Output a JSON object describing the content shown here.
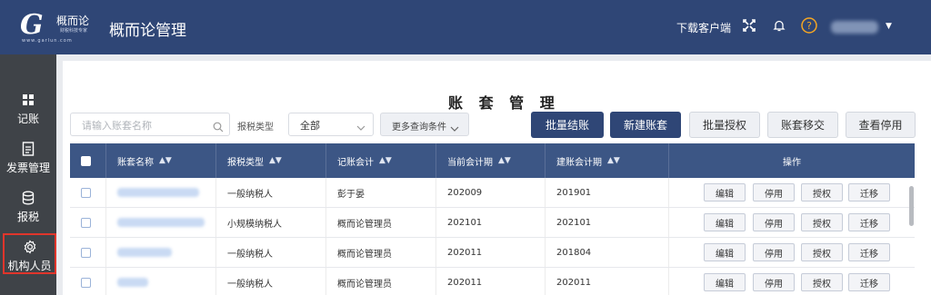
{
  "header": {
    "logo_letter": "G",
    "logo_cn": "概而论",
    "logo_subtitle": "财税科技专家",
    "logo_url": "www.garlun.com",
    "app_title": "概而论管理",
    "download_label": "下载客户端",
    "icons": [
      "fullscreen-icon",
      "bell-icon",
      "help-icon",
      "chevron-down-icon"
    ]
  },
  "sidebar": {
    "items": [
      {
        "label": "记账",
        "icon": "grid-icon"
      },
      {
        "label": "发票管理",
        "icon": "invoice-icon"
      },
      {
        "label": "报税",
        "icon": "database-icon"
      },
      {
        "label": "机构人员",
        "icon": "gear-icon",
        "active": true
      }
    ]
  },
  "page": {
    "title": "账 套 管 理"
  },
  "filters": {
    "search_placeholder": "请输入账套名称",
    "tax_type_label": "报税类型",
    "tax_type_value": "全部",
    "more_label": "更多查询条件"
  },
  "actions": {
    "batch_close": "批量结账",
    "new_book": "新建账套",
    "batch_auth": "批量授权",
    "transfer": "账套移交",
    "view_disabled": "查看停用"
  },
  "table": {
    "headers": {
      "name": "账套名称",
      "tax_type": "报税类型",
      "accountant": "记账会计",
      "current_period": "当前会计期",
      "created_period": "建账会计期",
      "actions": "操作"
    },
    "op_labels": {
      "edit": "编辑",
      "disable": "停用",
      "auth": "授权",
      "migrate": "迁移"
    },
    "rows": [
      {
        "tax_type": "一般纳税人",
        "accountant": "彭于晏",
        "current_period": "202009",
        "created_period": "201901"
      },
      {
        "tax_type": "小规模纳税人",
        "accountant": "概而论管理员",
        "current_period": "202101",
        "created_period": "202101"
      },
      {
        "tax_type": "一般纳税人",
        "accountant": "概而论管理员",
        "current_period": "202011",
        "created_period": "201804"
      },
      {
        "tax_type": "一般纳税人",
        "accountant": "概而论管理员",
        "current_period": "202011",
        "created_period": "202011"
      }
    ]
  },
  "colors": {
    "header_bg": "#2f4676",
    "sidebar_bg": "#3f4348",
    "table_head_bg": "#3c5685",
    "active_outline": "#e0352b",
    "help_icon": "#f5a623"
  }
}
